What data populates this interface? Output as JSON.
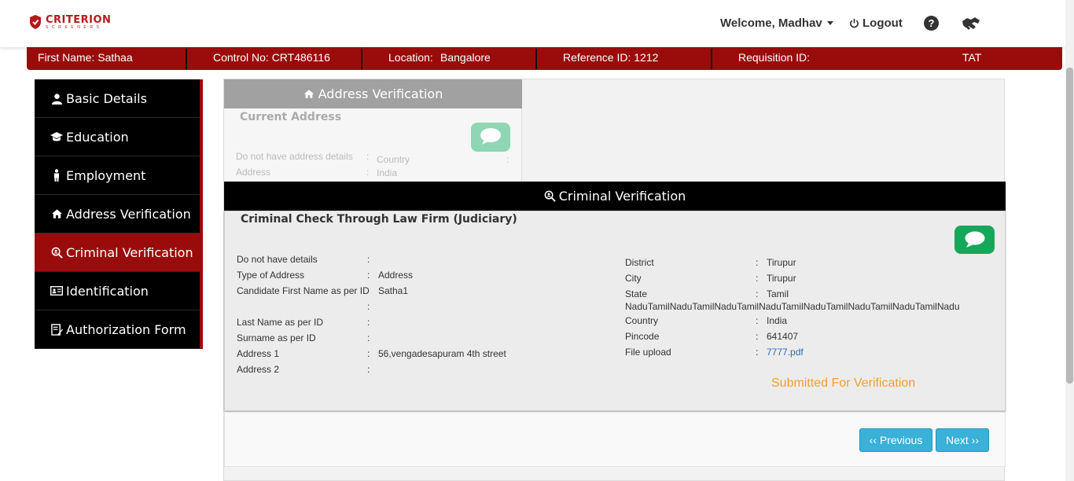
{
  "brand": {
    "name": "CRITERION",
    "tagline": "SCREENERS"
  },
  "header": {
    "welcome": "Welcome, Madhav",
    "logout": "Logout",
    "help_icon": "?",
    "icons": [
      "power-icon",
      "help-icon",
      "handshake-icon"
    ]
  },
  "info_bar": {
    "first_name": "First Name: Sathaa",
    "control_no": "Control No: CRT486116",
    "location_label": "Location:",
    "location_value": "Bangalore",
    "reference_id": "Reference ID: 1212",
    "requisition_id": "Requisition ID:",
    "tat": "TAT"
  },
  "sidebar": {
    "items": [
      {
        "label": "Basic Details",
        "icon": "user-icon"
      },
      {
        "label": "Education",
        "icon": "graduation-cap-icon"
      },
      {
        "label": "Employment",
        "icon": "person-icon"
      },
      {
        "label": "Address Verification",
        "icon": "home-icon"
      },
      {
        "label": "Criminal Verification",
        "icon": "magnifier-icon",
        "active": true
      },
      {
        "label": "Identification",
        "icon": "id-card-icon"
      },
      {
        "label": "Authorization Form",
        "icon": "form-edit-icon"
      }
    ]
  },
  "address_section": {
    "tab_label": "Address Verification",
    "title": "Current Address",
    "fields": [
      {
        "label": "Do not have address details",
        "value": ""
      },
      {
        "label": "Address",
        "value": ""
      }
    ],
    "right_fields": [
      {
        "label": "Country",
        "value": "India"
      }
    ]
  },
  "criminal_section": {
    "header": "Criminal Verification",
    "title": "Criminal Check Through Law Firm (Judiciary)",
    "left_fields": [
      {
        "label": "Do not have details",
        "value": ""
      },
      {
        "label": "Type of Address",
        "value": "Address"
      },
      {
        "label": "Candidate First Name as per ID",
        "value": "Satha1"
      },
      {
        "label": "Last Name as per ID",
        "value": ""
      },
      {
        "label": "Surname as per ID",
        "value": ""
      },
      {
        "label": "Address 1",
        "value": "56,vengadesapuram 4th street"
      },
      {
        "label": "Address 2",
        "value": ""
      }
    ],
    "right_fields": [
      {
        "label": "District",
        "value": "Tirupur"
      },
      {
        "label": "City",
        "value": "Tirupur"
      },
      {
        "label": "State",
        "value": "Tamil"
      },
      {
        "label": "",
        "value": "NaduTamilNaduTamilNaduTamilNaduTamilNaduTamilNaduTamilNaduTamilNadu"
      },
      {
        "label": "Country",
        "value": "India"
      },
      {
        "label": "Pincode",
        "value": "641407"
      },
      {
        "label": "File upload",
        "value": "7777.pdf"
      }
    ],
    "status": "Submitted For Verification"
  },
  "navigation": {
    "previous": "‹‹ Previous",
    "next": "Next ››"
  },
  "colors": {
    "brand_red": "#9a0c0c",
    "chat_green": "#16a85a",
    "status_orange": "#f0a030",
    "button_blue": "#39b1d9"
  }
}
